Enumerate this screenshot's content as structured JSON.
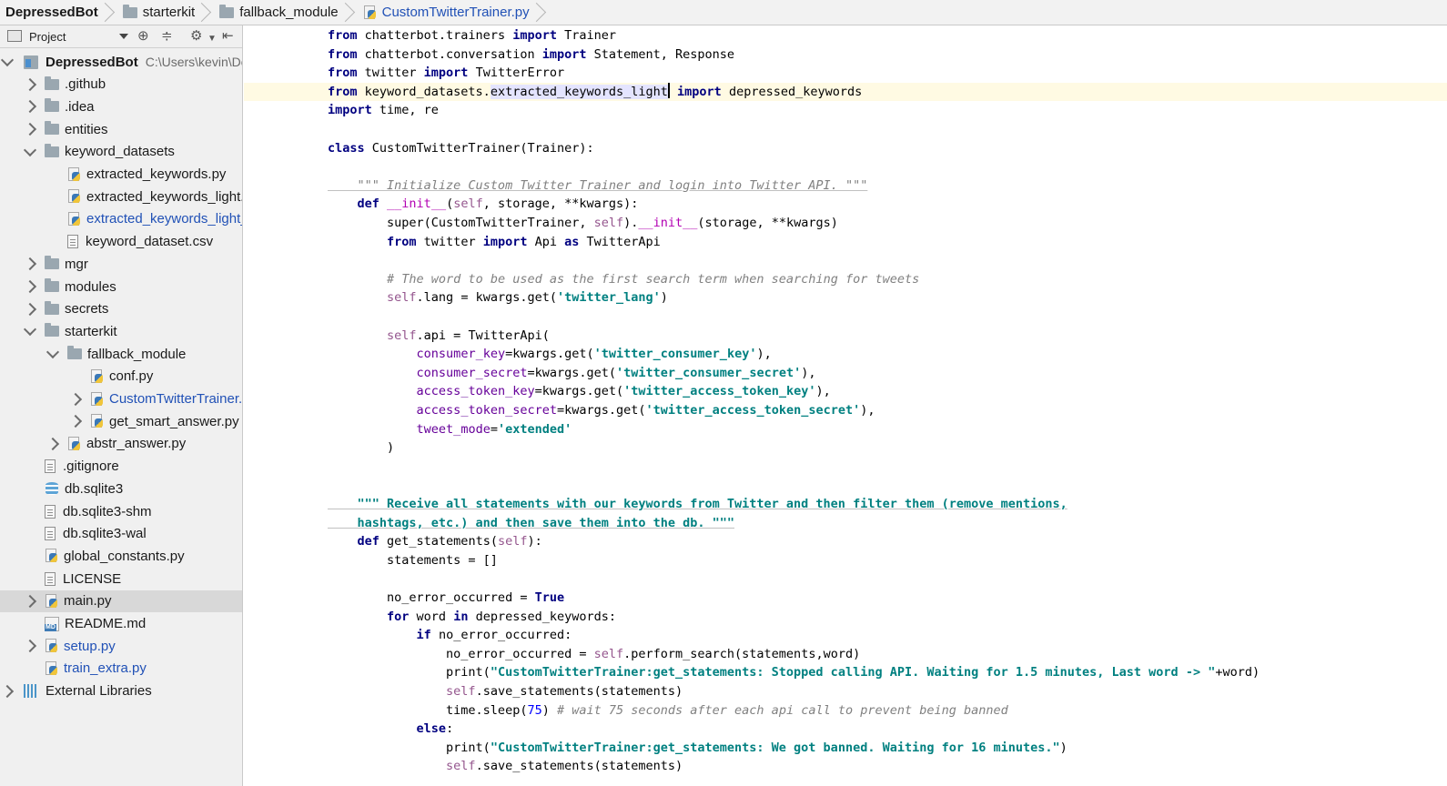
{
  "breadcrumb": [
    {
      "label": "DepressedBot",
      "icon": "project-icon"
    },
    {
      "label": "starterkit",
      "icon": "folder-icon"
    },
    {
      "label": "fallback_module",
      "icon": "folder-icon"
    },
    {
      "label": "CustomTwitterTrainer.py",
      "icon": "python-file-icon"
    }
  ],
  "project_panel": {
    "view_label": "Project",
    "tree": [
      {
        "label": "DepressedBot",
        "path": "C:\\Users\\kevin\\De",
        "icon": "project-icon",
        "arrow": "down",
        "depth": 0,
        "bold": true
      },
      {
        "label": ".github",
        "icon": "folder-icon",
        "arrow": "right",
        "depth": 1
      },
      {
        "label": ".idea",
        "icon": "folder-icon",
        "arrow": "right",
        "depth": 1
      },
      {
        "label": "entities",
        "icon": "folder-icon",
        "arrow": "right",
        "depth": 1
      },
      {
        "label": "keyword_datasets",
        "icon": "folder-icon",
        "arrow": "down",
        "depth": 1
      },
      {
        "label": "extracted_keywords.py",
        "icon": "python-file-icon",
        "arrow": "",
        "depth": 2
      },
      {
        "label": "extracted_keywords_light.",
        "icon": "python-file-icon",
        "arrow": "",
        "depth": 2
      },
      {
        "label": "extracted_keywords_light_",
        "icon": "python-file-icon",
        "arrow": "",
        "depth": 2,
        "blue": true
      },
      {
        "label": "keyword_dataset.csv",
        "icon": "text-file-icon",
        "arrow": "",
        "depth": 2
      },
      {
        "label": "mgr",
        "icon": "folder-icon",
        "arrow": "right",
        "depth": 1
      },
      {
        "label": "modules",
        "icon": "folder-icon",
        "arrow": "right",
        "depth": 1
      },
      {
        "label": "secrets",
        "icon": "folder-icon",
        "arrow": "right",
        "depth": 1
      },
      {
        "label": "starterkit",
        "icon": "folder-icon",
        "arrow": "down",
        "depth": 1
      },
      {
        "label": "fallback_module",
        "icon": "folder-icon",
        "arrow": "down",
        "depth": 2
      },
      {
        "label": "conf.py",
        "icon": "python-file-icon",
        "arrow": "",
        "depth": 3
      },
      {
        "label": "CustomTwitterTrainer.",
        "icon": "python-file-icon",
        "arrow": "right",
        "depth": 3,
        "blue": true
      },
      {
        "label": "get_smart_answer.py",
        "icon": "python-file-icon",
        "arrow": "right",
        "depth": 3
      },
      {
        "label": "abstr_answer.py",
        "icon": "python-file-icon",
        "arrow": "right",
        "depth": 2
      },
      {
        "label": ".gitignore",
        "icon": "text-file-icon",
        "arrow": "",
        "depth": 1
      },
      {
        "label": "db.sqlite3",
        "icon": "database-icon",
        "arrow": "",
        "depth": 1
      },
      {
        "label": "db.sqlite3-shm",
        "icon": "unknown-file-icon",
        "arrow": "",
        "depth": 1
      },
      {
        "label": "db.sqlite3-wal",
        "icon": "unknown-file-icon",
        "arrow": "",
        "depth": 1
      },
      {
        "label": "global_constants.py",
        "icon": "python-file-icon",
        "arrow": "",
        "depth": 1
      },
      {
        "label": "LICENSE",
        "icon": "text-file-icon",
        "arrow": "",
        "depth": 1
      },
      {
        "label": "main.py",
        "icon": "python-file-icon",
        "arrow": "right",
        "depth": 1,
        "selected": true
      },
      {
        "label": "README.md",
        "icon": "markdown-file-icon",
        "arrow": "",
        "depth": 1
      },
      {
        "label": "setup.py",
        "icon": "python-file-icon",
        "arrow": "right",
        "depth": 1,
        "blue": true
      },
      {
        "label": "train_extra.py",
        "icon": "python-file-icon",
        "arrow": "",
        "depth": 1,
        "blue": true
      },
      {
        "label": "External Libraries",
        "icon": "libraries-icon",
        "arrow": "right",
        "depth": 0
      }
    ]
  },
  "editor": {
    "lines": [
      "from chatterbot.trainers import Trainer",
      "from chatterbot.conversation import Statement, Response",
      "from twitter import TwitterError",
      "from keyword_datasets.extracted_keywords_light import depressed_keywords",
      "import time, re",
      "",
      "class CustomTwitterTrainer(Trainer):",
      "",
      "    \"\"\" Initialize Custom Twitter Trainer and login into Twitter API. \"\"\"",
      "    def __init__(self, storage, **kwargs):",
      "        super(CustomTwitterTrainer, self).__init__(storage, **kwargs)",
      "        from twitter import Api as TwitterApi",
      "",
      "        # The word to be used as the first search term when searching for tweets",
      "        self.lang = kwargs.get('twitter_lang')",
      "",
      "        self.api = TwitterApi(",
      "            consumer_key=kwargs.get('twitter_consumer_key'),",
      "            consumer_secret=kwargs.get('twitter_consumer_secret'),",
      "            access_token_key=kwargs.get('twitter_access_token_key'),",
      "            access_token_secret=kwargs.get('twitter_access_token_secret'),",
      "            tweet_mode='extended'",
      "        )",
      "",
      "",
      "    \"\"\" Receive all statements with our keywords from Twitter and then filter them (remove mentions,",
      "    hashtags, etc.) and then save them into the db. \"\"\"",
      "    def get_statements(self):",
      "        statements = []",
      "",
      "        no_error_occurred = True",
      "        for word in depressed_keywords:",
      "            if no_error_occurred:",
      "                no_error_occurred = self.perform_search(statements,word)",
      "                print(\"CustomTwitterTrainer:get_statements: Stopped calling API. Waiting for 1.5 minutes, Last word -> \"+word)",
      "                self.save_statements(statements)",
      "                time.sleep(75) # wait 75 seconds after each api call to prevent being banned",
      "            else:",
      "                print(\"CustomTwitterTrainer:get_statements: We got banned. Waiting for 16 minutes.\")",
      "                self.save_statements(statements)"
    ],
    "current_line": 4
  }
}
